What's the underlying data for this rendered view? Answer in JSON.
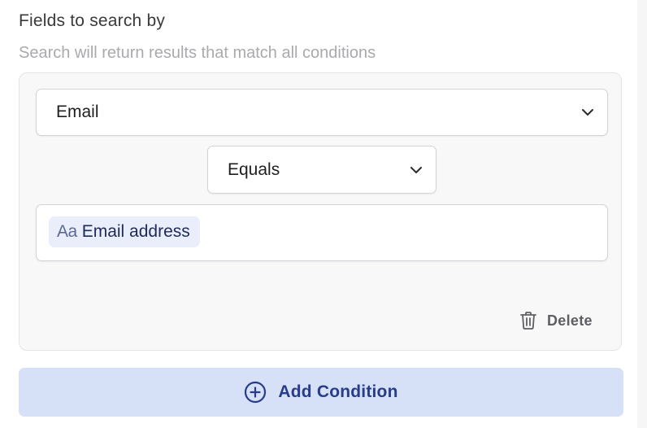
{
  "section": {
    "title": "Fields to search by",
    "description": "Search will return results that match all conditions"
  },
  "condition": {
    "field": {
      "selected": "Email",
      "icon": "chevron-down-icon"
    },
    "operator": {
      "selected": "Equals",
      "icon": "chevron-down-icon"
    },
    "value": {
      "token_icon_text": "Aa",
      "token_label": "Email address"
    },
    "delete": {
      "label": "Delete",
      "icon": "trash-icon"
    }
  },
  "add_condition": {
    "label": "Add Condition",
    "icon": "plus-circle-icon"
  },
  "colors": {
    "card_bg": "#f8f8f9",
    "chip_bg": "#eaeefb",
    "add_button_bg": "#d6e0f7",
    "accent": "#273c8a"
  }
}
